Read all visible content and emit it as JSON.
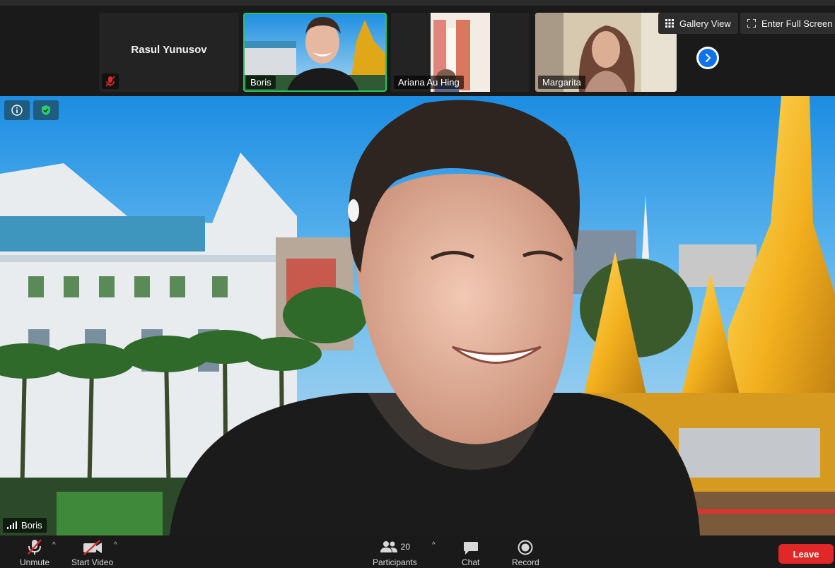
{
  "window": {
    "accent_color": "#0e72ed",
    "active_speaker_color": "#22c55e",
    "leave_color": "#e02828"
  },
  "gallery_strip": {
    "tiles": [
      {
        "name": "Rasul Yunusov",
        "video": false,
        "muted": true
      },
      {
        "name": "Boris",
        "video": true,
        "active_speaker": true
      },
      {
        "name": "Ariana Au Hing",
        "video": true
      },
      {
        "name": "Margarita",
        "video": true
      }
    ],
    "gallery_view_label": "Gallery View",
    "fullscreen_label": "Enter Full Screen"
  },
  "main_video": {
    "speaker_name": "Boris",
    "info_icon": "info-icon",
    "security_icon": "shield-check-icon"
  },
  "toolbar": {
    "unmute_label": "Unmute",
    "start_video_label": "Start Video",
    "participants_label": "Participants",
    "participants_count": "20",
    "chat_label": "Chat",
    "record_label": "Record",
    "leave_label": "Leave"
  }
}
